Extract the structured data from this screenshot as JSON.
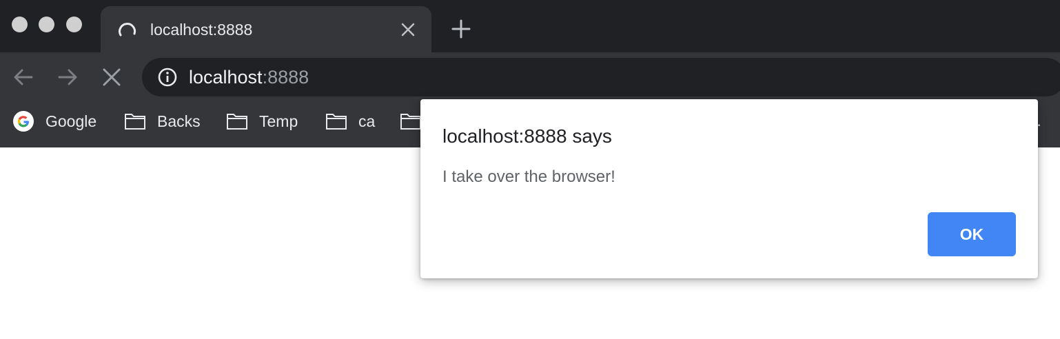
{
  "tab": {
    "title": "localhost:8888",
    "loading": true
  },
  "omnibox": {
    "url_host": "localhost",
    "url_port": ":8888"
  },
  "bookmarks": [
    {
      "label": "Google",
      "icon": "google-icon"
    },
    {
      "label": "Backs",
      "icon": "folder-icon"
    },
    {
      "label": "Temp",
      "icon": "folder-icon"
    },
    {
      "label": "ca",
      "icon": "folder-icon"
    }
  ],
  "bookmarks_overflow": "..",
  "dialog": {
    "title": "localhost:8888 says",
    "message": "I take over the browser!",
    "ok_label": "OK"
  },
  "colors": {
    "tabstrip_bg": "#202124",
    "toolbar_bg": "#35363a",
    "ok_button": "#4285f4"
  }
}
